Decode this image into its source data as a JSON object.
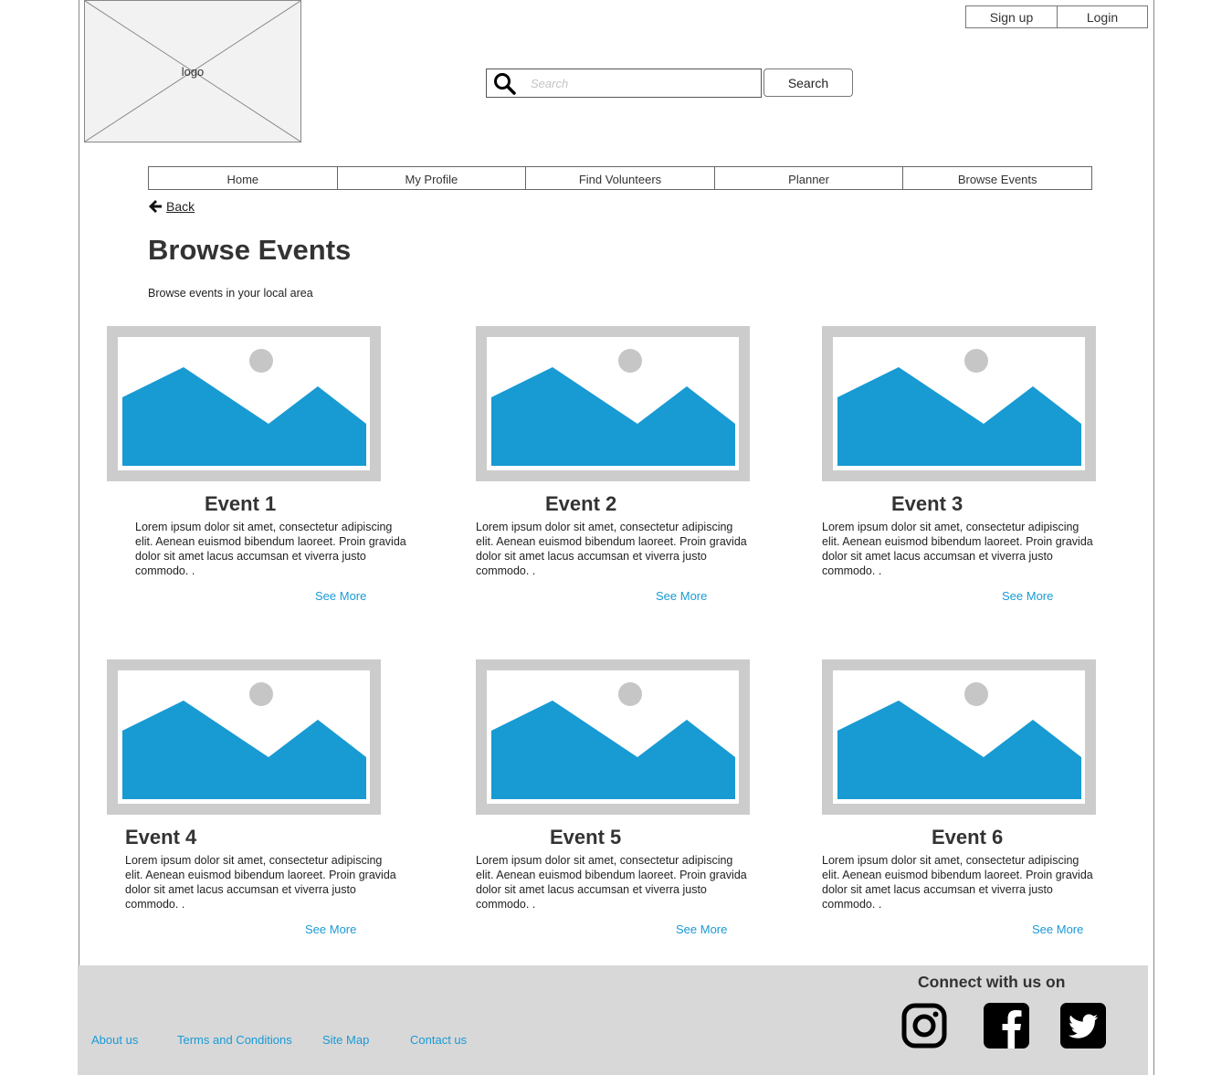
{
  "header": {
    "logo_label": "logo",
    "signup_label": "Sign up",
    "login_label": "Login",
    "search_placeholder": "Search",
    "search_button_label": "Search"
  },
  "nav": {
    "items": [
      {
        "label": "Home"
      },
      {
        "label": "My Profile"
      },
      {
        "label": "Find Volunteers"
      },
      {
        "label": "Planner"
      },
      {
        "label": "Browse Events"
      }
    ]
  },
  "back_label": "Back",
  "page": {
    "title": "Browse Events",
    "subtitle": "Browse events in your local area"
  },
  "events": [
    {
      "title": "Event 1",
      "description": "Lorem ipsum dolor sit amet, consectetur adipiscing elit. Aenean euismod bibendum laoreet. Proin gravida dolor sit amet lacus accumsan et viverra justo commodo. .",
      "see_more": "See More"
    },
    {
      "title": "Event 2",
      "description": "Lorem ipsum dolor sit amet, consectetur adipiscing elit. Aenean euismod bibendum laoreet. Proin gravida dolor sit amet lacus accumsan et viverra justo commodo. .",
      "see_more": "See More"
    },
    {
      "title": "Event 3",
      "description": "Lorem ipsum dolor sit amet, consectetur adipiscing elit. Aenean euismod bibendum laoreet. Proin gravida dolor sit amet lacus accumsan et viverra justo commodo. .",
      "see_more": "See More"
    },
    {
      "title": "Event 4",
      "description": "Lorem ipsum dolor sit amet, consectetur adipiscing elit. Aenean euismod bibendum laoreet. Proin gravida dolor sit amet lacus accumsan et viverra justo commodo. .",
      "see_more": "See More"
    },
    {
      "title": "Event 5",
      "description": "Lorem ipsum dolor sit amet, consectetur adipiscing elit. Aenean euismod bibendum laoreet. Proin gravida dolor sit amet lacus accumsan et viverra justo commodo. .",
      "see_more": "See More"
    },
    {
      "title": "Event 6",
      "description": "Lorem ipsum dolor sit amet, consectetur adipiscing elit. Aenean euismod bibendum laoreet. Proin gravida dolor sit amet lacus accumsan et viverra justo commodo. .",
      "see_more": "See More"
    }
  ],
  "footer": {
    "links": [
      {
        "label": "About us"
      },
      {
        "label": "Terms and Conditions"
      },
      {
        "label": "Site Map"
      },
      {
        "label": "Contact us"
      }
    ],
    "connect_label": "Connect with us on",
    "social_icons": [
      "instagram-icon",
      "facebook-icon",
      "twitter-icon"
    ]
  },
  "colors": {
    "accent": "#1a9ad6",
    "image_placeholder_fill": "#189ad3",
    "image_placeholder_frame": "#cccccc",
    "footer_bg": "#d8d8d8"
  }
}
